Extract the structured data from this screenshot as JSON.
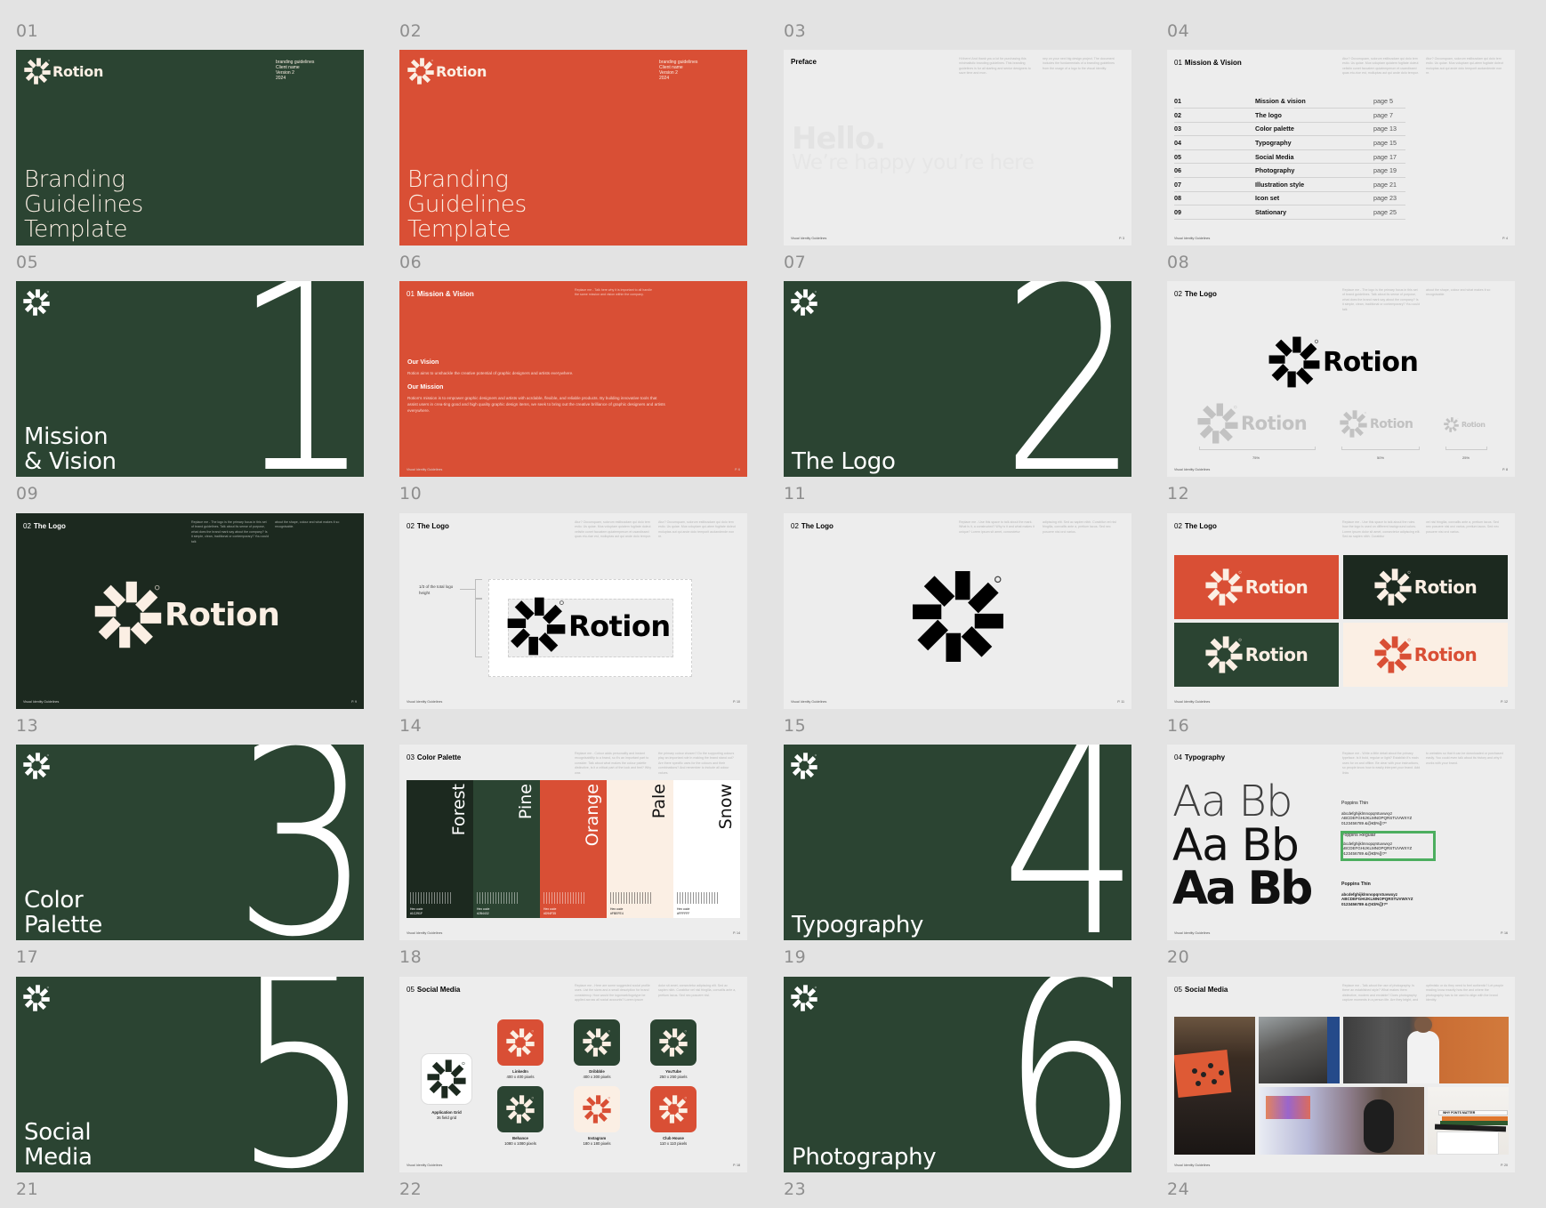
{
  "page": {
    "background": "#e3e3e3"
  },
  "colors": {
    "pine": "#2b4432",
    "forest": "#1c291f",
    "orange": "#d94f35",
    "pale": "#fbefe4",
    "snow": "#ffffff",
    "highlight": "#4cae5f"
  },
  "brand": {
    "name": "Rotion",
    "trademark": "®"
  },
  "labels": [
    "01",
    "02",
    "03",
    "04",
    "05",
    "06",
    "07",
    "08",
    "09",
    "10",
    "11",
    "12",
    "13",
    "14",
    "15",
    "16",
    "17",
    "18",
    "19",
    "20",
    "21",
    "22",
    "23",
    "24"
  ],
  "footer": "Visual Identity Guidelines",
  "slides": {
    "s01": {
      "meta": [
        "branding guidelines",
        "Client name",
        "Version 2",
        "2024"
      ],
      "title": [
        "Branding",
        "Guidelines",
        "Template"
      ]
    },
    "s02": {
      "meta": [
        "branding guidelines",
        "Client name",
        "Version 2",
        "2024"
      ],
      "title": [
        "Branding",
        "Guidelines",
        "Template"
      ]
    },
    "s03": {
      "heading": "Preface",
      "hello": "Hello.",
      "subtitle": "We’re happy you’re here",
      "col1": "Hi there! And thank you a lot for purchasing this minimalistic branding guidelines. This branding guidelines is for all starting and senior designers to save time and mon-",
      "col2": "ney on your next big design project. The document includes the fundamentals of a branding guidelines from the usage of a logo to the visual identity.",
      "page": "P. 3"
    },
    "s04": {
      "index": "01",
      "heading": "Mission & Vision",
      "col1": "Atur? Occumquam, solorum estibusdam qui dolo tem estio. Us quiae. Mus voluptam quiatem fugitate doleut velistin conet faccatem quiatemperum et usandissed quas etu-rioe est, molluptas aut qui ande dolo tempor.",
      "col2": "Atur? Occumquam, solorum estibusdam qui dolo tem estio. Us quiae. Mus voluptam qui-atem fugitate doleut moluptas aut qui ande dolo temporit audandende non re.",
      "toc": [
        {
          "n": "01",
          "t": "Mission & vision",
          "p": "page 5"
        },
        {
          "n": "02",
          "t": "The logo",
          "p": "page 7"
        },
        {
          "n": "03",
          "t": "Color palette",
          "p": "page 13"
        },
        {
          "n": "04",
          "t": "Typography",
          "p": "page 15"
        },
        {
          "n": "05",
          "t": "Social Media",
          "p": "page 17"
        },
        {
          "n": "06",
          "t": "Photography",
          "p": "page 19"
        },
        {
          "n": "07",
          "t": "Illustration style",
          "p": "page 21"
        },
        {
          "n": "08",
          "t": "Icon set",
          "p": "page 23"
        },
        {
          "n": "09",
          "t": "Stationary",
          "p": "page 25"
        }
      ],
      "page": "P. 4"
    },
    "s05": {
      "number": "1",
      "title": [
        "Mission",
        "& Vision"
      ]
    },
    "s06": {
      "index": "01",
      "heading": "Mission & Vision",
      "note": "Replace me - Talk here why it is important to all handle the same mission and vision within the company.",
      "vision_h": "Our Vision",
      "vision": "Rotion aims to unshackle the creative potential of graphic designers and artists everywhere.",
      "mission_h": "Our Mission",
      "mission": "Rotion's mission is to empower graphic designers and artists with acrdable, flexible, and reliable products. By building innovative tools that assist users in crea-ting good and high quality graphic design items, we seek to bring out the creative brilliance of graphic designers and artists everywhere.",
      "page": "P. 6"
    },
    "s07": {
      "number": "2",
      "title": [
        "The Logo"
      ]
    },
    "s08": {
      "index": "02",
      "heading": "The Logo",
      "col1": "Replace me - The logo is the primary focus in this set of brand guidelines. Talk about its sense of purpose, what does the brand mark say about the company? Is it simple, clean, traditional or contemporary? You could talk",
      "col2": "about the shape, colour and what makes it so recognisable.",
      "scales": [
        "75%",
        "50%",
        "25%"
      ],
      "page": "P. 8"
    },
    "s09": {
      "index": "02",
      "heading": "The Logo",
      "col1": "Replace me - The logo is the primary focus in this set of brand guidelines. Talk about its sense of purpose, what does the brand mark say about the company? Is it simple, clean, traditional or contemporary? You could talk",
      "col2": "about the shape, colour and what makes it so recognisable.",
      "page": "P. 9"
    },
    "s10": {
      "index": "02",
      "heading": "The Logo",
      "col1": "Atur? Occumquam, solorum estibusdam qui dolo tem estio. Us quiae. Mus voluptam quiatem fugitate doleut velistin conet faccatem quiatemperum et usandissed quas etu-riae est, molluptas aut qui ande dolo tempor.",
      "col2": "Atur? Occumquam, solorum estibusdam qui dolo tem estio. Us quiae. Mus voluptam qui-atem fugitate doleut moluptas aut qui ande dolo temporit audandende non re.",
      "clearspace_note": "1/3 of the total logo height",
      "page": "P. 10"
    },
    "s11": {
      "index": "02",
      "heading": "The Logo",
      "col1": "Replace me - Use this space to talk about the mark. What is it, a constructed? Why is it and what makes it unique? Lorem ipsum sit amet, consectetur",
      "col2": "adipiscing elit. Sed ac sapien nibh. Curabitur vel nisl fringilla, convallis ante a, pretium lacus. Sed nec posuere nisi orci varius.",
      "page": "P. 11"
    },
    "s12": {
      "index": "02",
      "heading": "The Logo",
      "col1": "Replace me - Use this space to talk about the rules how the logo is used on different background colors. Lorem ipsum dolor sit amet, consectetur adipiscing elit. Sed ac sapien nibh. Curabitur",
      "col2": "vel nisl fringilla, convallis ante a, pretium lacus. Sed nec posuere nisi orci varius, pretium lacus. Sed nec posuere nisi orci varius.",
      "page": "P. 12"
    },
    "s13": {
      "number": "3",
      "title": [
        "Color",
        "Palette"
      ]
    },
    "s14": {
      "index": "03",
      "heading": "Color Palette",
      "col1": "Replace me - Colour adds personality and instant recognisability to a brand, so it's an important part to consider. Talk about what makes the colour palette distinctive, is it a critical part of the look and feel? Why was",
      "col2": "the primary colour chosen? Do the supporting colours play an important role in making the brand stand out? Are there specific uses for the colours and their combinations? And remember to include all colour values.",
      "swatches": [
        {
          "name": "Forest",
          "hex_label": "Hex code",
          "hex": "#1C291F"
        },
        {
          "name": "Pine",
          "hex_label": "Hex code",
          "hex": "#2B4432"
        },
        {
          "name": "Orange",
          "hex_label": "Hex code",
          "hex": "#D94F35"
        },
        {
          "name": "Pale",
          "hex_label": "Hex code",
          "hex": "#FBEFE4"
        },
        {
          "name": "Snow",
          "hex_label": "Hex code",
          "hex": "#FFFFFF"
        }
      ],
      "page": "P. 14"
    },
    "s15": {
      "number": "4",
      "title": [
        "Typography"
      ]
    },
    "s16": {
      "index": "04",
      "heading": "Typography",
      "col1": "Replace me - Write a little detail about the primary typeface. Is it bold, regular or light? Establish it's main uses for on and offline. Be clear with your instructions, so people know how to easily interpret your brand. Add links",
      "col2": "to websites so that it can be downloaded or purchased easily. You could even talk about its history and why it works with your brand.",
      "specimen": "Aa Bb",
      "fonts": [
        {
          "name": "Poppins Thin",
          "lower": "abcdefghijklmnopqrstuvwxyz",
          "upper": "ABCDEFGHIJKLMNOPQRSTUVWXYZ",
          "digits": "0123456789 &@€$%[]!?*"
        },
        {
          "name": "Poppins Regular",
          "lower": "abcdefghijklmnopqrstuvwxyz",
          "upper": "ABCDEFGHIJKLMNOPQRSTUVWXYZ",
          "digits": "0123456789 &@€$%[]!?*"
        },
        {
          "name": "Poppins Thin",
          "lower": "abcdefghijklmnopqrstuvwxyz",
          "upper": "ABCDEFGHIJKLMNOPQRSTUVWXYZ",
          "digits": "0123456789 &@€$%[]!?*"
        }
      ],
      "page": "P. 16"
    },
    "s17": {
      "number": "5",
      "title": [
        "Social",
        "Media"
      ]
    },
    "s18": {
      "index": "05",
      "heading": "Social Media",
      "col1": "Replace me - Here are some suggested social profile uses. List the sizes and a small description for brand consistency. How would the logomark/logotype be applied across all social accounts? Lorem ipsum",
      "col2": "dolor sit amet, consectetur adipiscing elit. Sed ac sapien nibh. Curabitur vel nisl fringilla, convallis ante a, pretium lacus. Sed nec posuere nisl.",
      "app": {
        "name": "Application Grid",
        "desc": "36 field grid"
      },
      "profiles": [
        {
          "name": "LinkedIn",
          "size": "400 x 400 pixels",
          "bg": "#d94f35",
          "fg": "#fbefe4"
        },
        {
          "name": "Dribbble",
          "size": "400 x 300 pixels",
          "bg": "#2b4432",
          "fg": "#fbefe4"
        },
        {
          "name": "YouTube",
          "size": "250 x 250 pixels",
          "bg": "#2b4432",
          "fg": "#fbefe4"
        },
        {
          "name": "Behance",
          "size": "1080 x 1080 pixels",
          "bg": "#2b4432",
          "fg": "#fbefe4"
        },
        {
          "name": "Instagram",
          "size": "180 x 180 pixels",
          "bg": "#fbefe4",
          "fg": "#d94f35"
        },
        {
          "name": "Club House",
          "size": "110 x 110 pixels",
          "bg": "#d94f35",
          "fg": "#fbefe4"
        }
      ],
      "page": "P. 18"
    },
    "s19": {
      "number": "6",
      "title": [
        "Photography"
      ]
    },
    "s20": {
      "index": "05",
      "heading": "Social Media",
      "col1": "Replace me - Talk about the use of photography. Is there an established style? What makes them distinctive, modern and enviable? Does photography capture moments in a person life. Are they bright, and",
      "col2": "optimistic or do they need to feel authentic? Let people reading know exactly how the and where the photography has to be used to align with the brand identity.",
      "book_title": "WHY FONTS MATTER",
      "page": "P. 20"
    }
  }
}
